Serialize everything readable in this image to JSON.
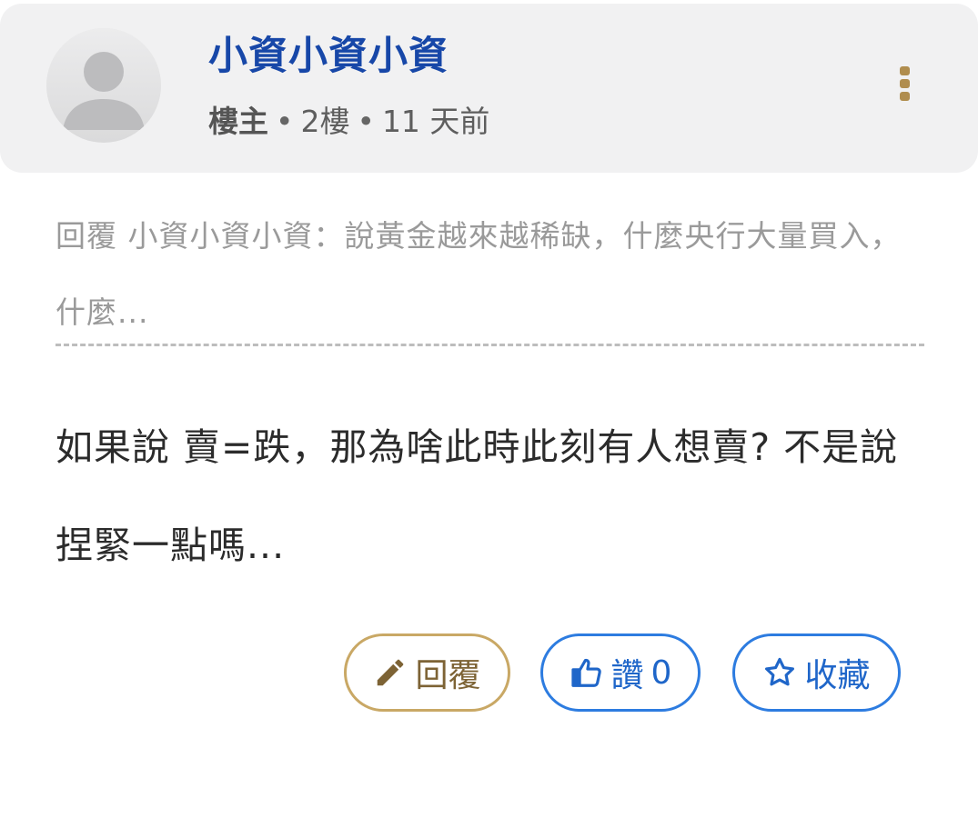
{
  "post": {
    "username": "小資小資小資",
    "role": "樓主",
    "floor": "2樓",
    "time": "11 天前",
    "quote": "回覆 小資小資小資：說黃金越來越稀缺，什麼央行大量買入，什麼...",
    "content": "如果說 賣=跌，那為啥此時此刻有人想賣? 不是說捏緊一點嗎..."
  },
  "actions": {
    "reply_label": "回覆",
    "like_label": "讚",
    "like_count": "0",
    "favorite_label": "收藏"
  },
  "icons": {
    "avatar": "default-avatar-icon",
    "more": "more-vertical-icon",
    "reply": "pencil-icon",
    "like": "thumbs-up-icon",
    "favorite": "star-outline-icon"
  },
  "colors": {
    "username": "#1747a8",
    "accent_gold": "#b08d4e",
    "accent_blue": "#2d7ce0",
    "header_bg": "#f1f1f2"
  }
}
